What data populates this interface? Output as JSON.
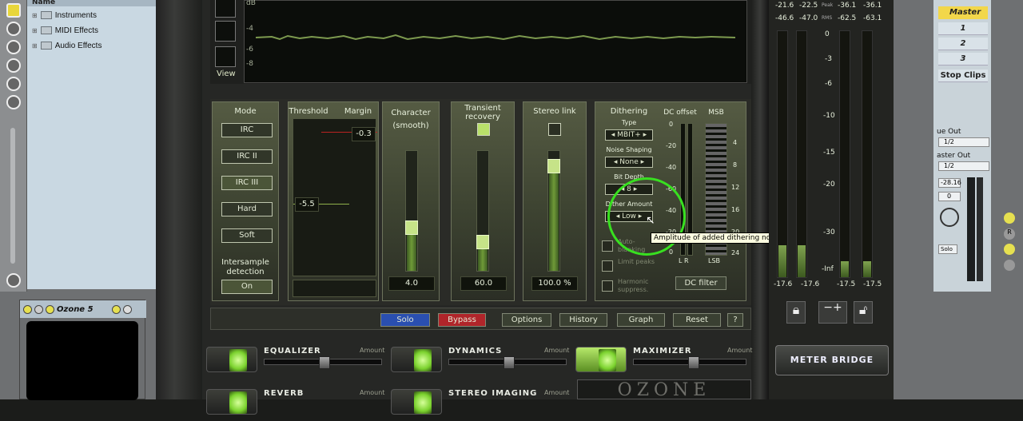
{
  "browser": {
    "header": "Name",
    "items": [
      {
        "label": "Instruments"
      },
      {
        "label": "MIDI Effects"
      },
      {
        "label": "Audio Effects"
      }
    ]
  },
  "device": {
    "title": "Ozone 5"
  },
  "waveform": {
    "db_labels": [
      "dB",
      "-4",
      "-6",
      "-8"
    ],
    "view_label": "View"
  },
  "mode": {
    "title": "Mode",
    "buttons": [
      "IRC",
      "IRC II",
      "IRC III",
      "Hard",
      "Soft"
    ],
    "selected": "IRC III",
    "intersample_label": "Intersample detection",
    "intersample_value": "On"
  },
  "threshold": {
    "title": "Threshold",
    "margin_title": "Margin",
    "threshold_value": "-5.5",
    "margin_value": "-0.3"
  },
  "character": {
    "title": "Character (smooth)",
    "value": "4.0",
    "level": 0.42
  },
  "transient": {
    "title": "Transient recovery",
    "value": "60.0",
    "level": 0.3
  },
  "stereo": {
    "title": "Stereo link",
    "value": "100.0 %",
    "level": 0.93
  },
  "dithering": {
    "title": "Dithering",
    "type_label": "Type",
    "type_value": "MBIT+",
    "shaping_label": "Noise Shaping",
    "shaping_value": "None",
    "bitdepth_label": "Bit Depth",
    "bitdepth_value": "8",
    "amount_label": "Dither Amount",
    "amount_value": "Low",
    "tooltip": "Amplitude of added dithering noise",
    "options": [
      "Auto-blanking",
      "Limit peaks",
      "Harmonic suppress."
    ]
  },
  "dc": {
    "title": "DC offset",
    "scale": [
      "0",
      "-20",
      "-40",
      "-60",
      "-40",
      "-20",
      "0"
    ],
    "lr": "L R",
    "button": "DC filter"
  },
  "msb": {
    "title": "MSB",
    "scale": [
      "4",
      "8",
      "12",
      "16",
      "20",
      "24"
    ],
    "lsb": "LSB"
  },
  "toolbar": {
    "solo": "Solo",
    "bypass": "Bypass",
    "options": "Options",
    "history": "History",
    "graph": "Graph",
    "reset": "Reset",
    "help": "?",
    "colors": {
      "solo": "#2a4fb0",
      "bypass": "#b0252a"
    }
  },
  "modules": [
    {
      "name": "EQUALIZER",
      "amount": "Amount"
    },
    {
      "name": "DYNAMICS",
      "amount": "Amount"
    },
    {
      "name": "MAXIMIZER",
      "amount": "Amount"
    },
    {
      "name": "REVERB",
      "amount": "Amount"
    },
    {
      "name": "STEREO IMAGING",
      "amount": "Amount"
    }
  ],
  "logo": "OZONE",
  "meter_bridge": {
    "peak_label": "Peak",
    "rms_label": "RMS",
    "peak_values": [
      "-21.6",
      "-22.5",
      "-36.1",
      "-36.1"
    ],
    "rms_values": [
      "-46.6",
      "-47.0",
      "-62.5",
      "-63.1"
    ],
    "scale": [
      "0",
      "-3",
      "-6",
      "-10",
      "-15",
      "-20",
      "-30",
      "-Inf"
    ],
    "bottom_values": [
      "-17.6",
      "-17.6",
      "-17.5",
      "-17.5"
    ],
    "button": "METER BRIDGE"
  },
  "mixer": {
    "master": "Master",
    "clips": [
      "1",
      "2",
      "3"
    ],
    "stop_clips": "Stop Clips",
    "cue_out": "ue Out",
    "cue_val": "1/2",
    "master_out": "aster Out",
    "master_val": "1/2",
    "vol": "-28.16",
    "pan": "0",
    "solo": "Solo"
  }
}
